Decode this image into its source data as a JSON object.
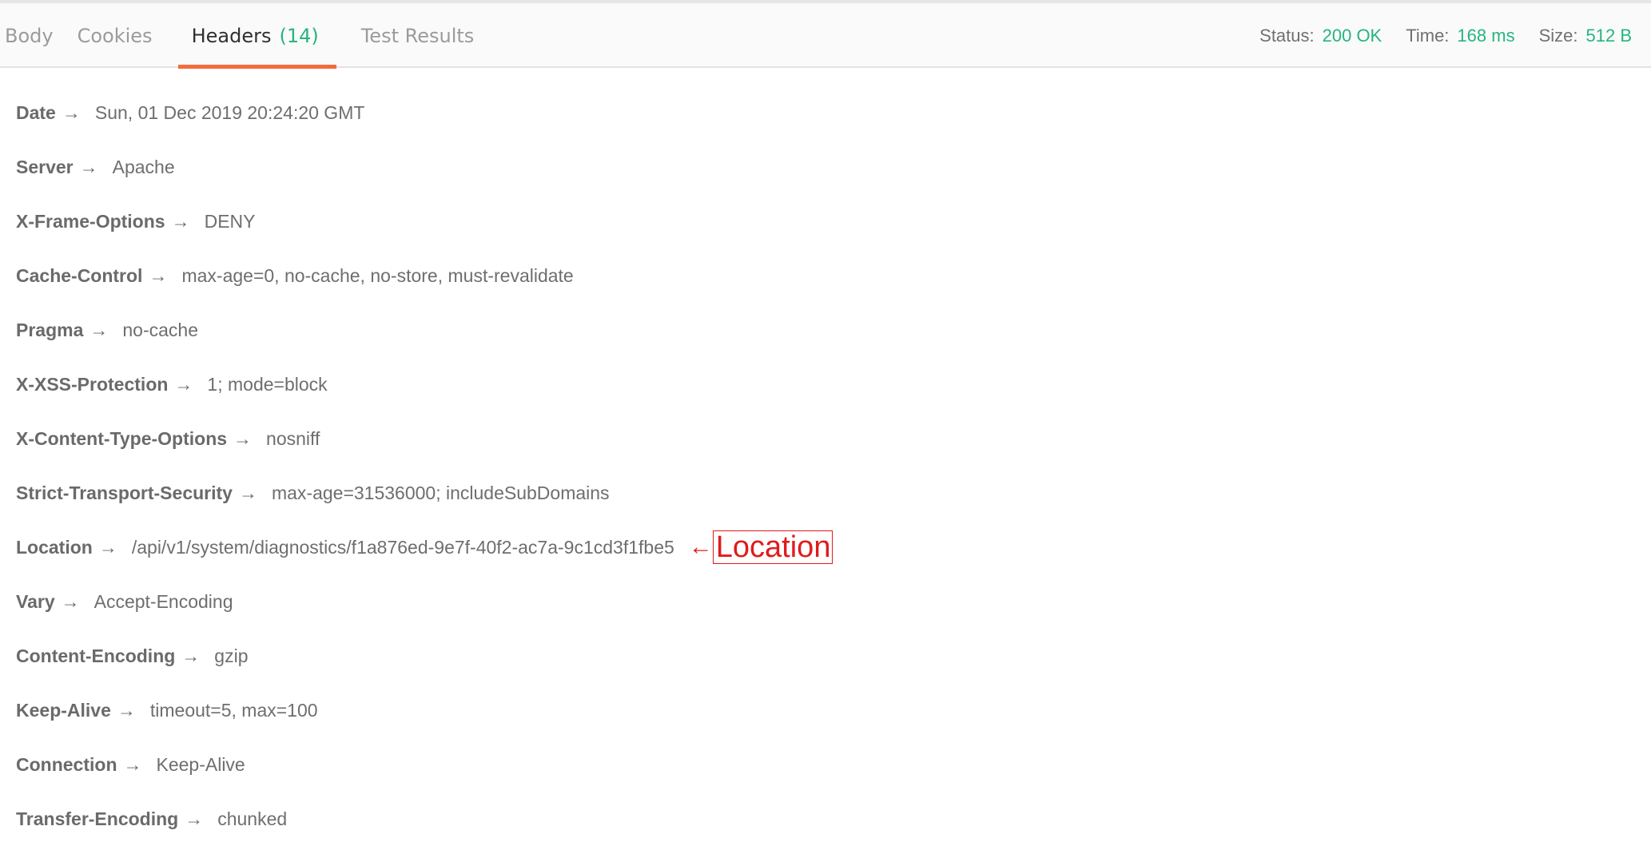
{
  "tabs": [
    {
      "label": "Body"
    },
    {
      "label": "Cookies"
    },
    {
      "label": "Headers",
      "count": "(14)"
    },
    {
      "label": "Test Results"
    }
  ],
  "stats": {
    "status_label": "Status:",
    "status_value": "200 OK",
    "time_label": "Time:",
    "time_value": "168 ms",
    "size_label": "Size:",
    "size_value": "512 B"
  },
  "arrow_glyph": "→",
  "headers": [
    {
      "key": "Date",
      "value": "Sun, 01 Dec 2019 20:24:20 GMT"
    },
    {
      "key": "Server",
      "value": "Apache"
    },
    {
      "key": "X-Frame-Options",
      "value": "DENY"
    },
    {
      "key": "Cache-Control",
      "value": "max-age=0, no-cache, no-store, must-revalidate"
    },
    {
      "key": "Pragma",
      "value": "no-cache"
    },
    {
      "key": "X-XSS-Protection",
      "value": "1; mode=block"
    },
    {
      "key": "X-Content-Type-Options",
      "value": "nosniff"
    },
    {
      "key": "Strict-Transport-Security",
      "value": "max-age=31536000; includeSubDomains"
    },
    {
      "key": "Location",
      "value": "/api/v1/system/diagnostics/f1a876ed-9e7f-40f2-ac7a-9c1cd3f1fbe5"
    },
    {
      "key": "Vary",
      "value": "Accept-Encoding"
    },
    {
      "key": "Content-Encoding",
      "value": "gzip"
    },
    {
      "key": "Keep-Alive",
      "value": "timeout=5, max=100"
    },
    {
      "key": "Connection",
      "value": "Keep-Alive"
    },
    {
      "key": "Transfer-Encoding",
      "value": "chunked"
    }
  ],
  "annotation": {
    "arrow": "←",
    "label": "Location",
    "color": "#e01b1b"
  },
  "colors": {
    "accent": "#f26b3a",
    "success": "#26b47f"
  }
}
